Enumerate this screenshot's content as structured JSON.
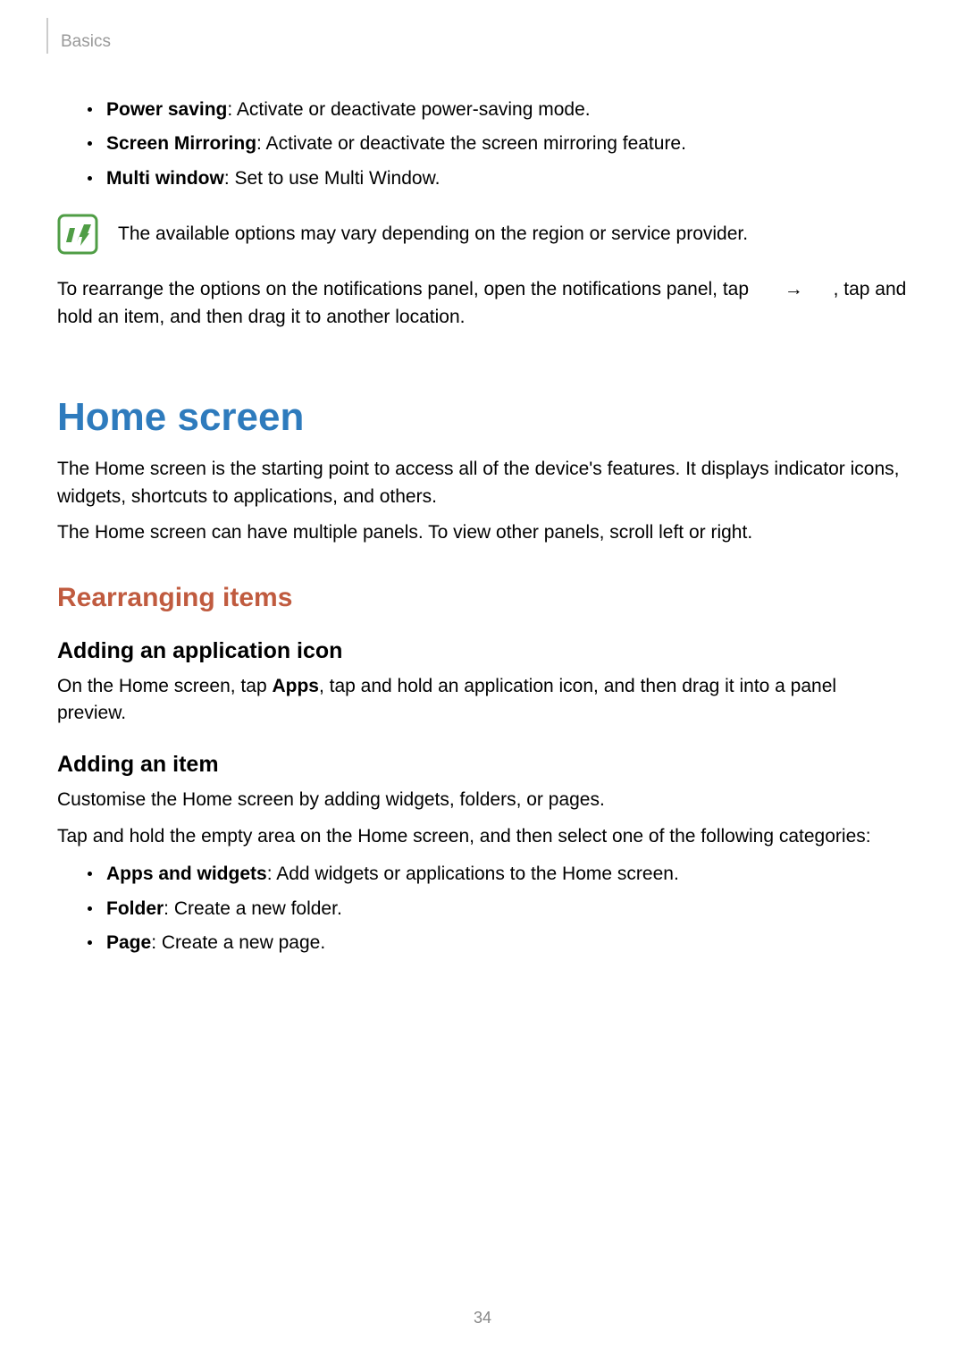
{
  "header": {
    "section": "Basics"
  },
  "top_bullets": [
    {
      "bold": "Power saving",
      "rest": ": Activate or deactivate power-saving mode."
    },
    {
      "bold": "Screen Mirroring",
      "rest": ": Activate or deactivate the screen mirroring feature."
    },
    {
      "bold": "Multi window",
      "rest": ": Set to use Multi Window."
    }
  ],
  "note": "The available options may vary depending on the region or service provider.",
  "rearrange_before_placeholder": "To rearrange the options on the notifications panel, open the notifications panel, tap ",
  "arrow": "→",
  "rearrange_after_placeholder": ", tap and hold an item, and then drag it to another location.",
  "home_screen": {
    "title": "Home screen",
    "p1": "The Home screen is the starting point to access all of the device's features. It displays indicator icons, widgets, shortcuts to applications, and others.",
    "p2": "The Home screen can have multiple panels. To view other panels, scroll left or right.",
    "rearranging": {
      "title": "Rearranging items",
      "adding_app_icon": {
        "title": "Adding an application icon",
        "text_before": "On the Home screen, tap ",
        "apps": "Apps",
        "text_after": ", tap and hold an application icon, and then drag it into a panel preview."
      },
      "adding_item": {
        "title": "Adding an item",
        "p1": "Customise the Home screen by adding widgets, folders, or pages.",
        "p2": "Tap and hold the empty area on the Home screen, and then select one of the following categories:",
        "bullets": [
          {
            "bold": "Apps and widgets",
            "rest": ": Add widgets or applications to the Home screen."
          },
          {
            "bold": "Folder",
            "rest": ": Create a new folder."
          },
          {
            "bold": "Page",
            "rest": ": Create a new page."
          }
        ]
      }
    }
  },
  "page_number": "34"
}
